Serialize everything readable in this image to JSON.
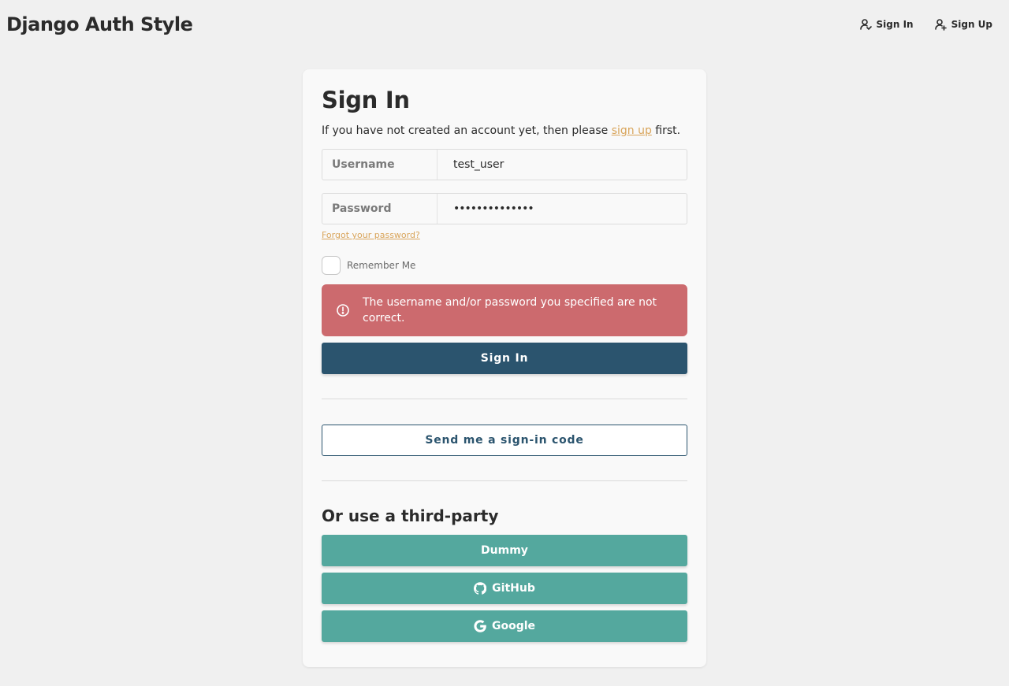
{
  "header": {
    "brand": "Django Auth Style",
    "nav": [
      {
        "label": "Sign In",
        "icon": "user-icon"
      },
      {
        "label": "Sign Up",
        "icon": "user-plus-icon"
      }
    ]
  },
  "form": {
    "title": "Sign In",
    "intro_before": "If you have not created an account yet, then please ",
    "intro_link": "sign up",
    "intro_after": " first.",
    "username": {
      "label": "Username",
      "value": "test_user"
    },
    "password": {
      "label": "Password",
      "value": "••••••••••••••"
    },
    "forgot_link": "Forgot your password?",
    "remember_label": "Remember Me",
    "error_message": "The username and/or password you specified are not correct.",
    "submit_label": "Sign In",
    "code_button_label": "Send me a sign-in code"
  },
  "third_party": {
    "title": "Or use a third-party",
    "providers": [
      {
        "label": "Dummy"
      },
      {
        "label": "GitHub",
        "icon": "github-icon"
      },
      {
        "label": "Google",
        "icon": "google-icon"
      }
    ]
  },
  "colors": {
    "primary": "#2b546e",
    "link": "#d9a55b",
    "error": "#cc6a6e",
    "social": "#54a89e"
  }
}
